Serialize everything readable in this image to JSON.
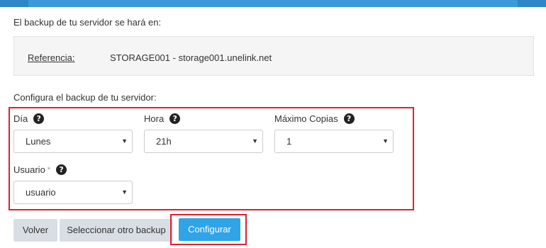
{
  "intro_text": "El backup de tu servidor se hará en:",
  "reference": {
    "label": "Referencia:",
    "value": "STORAGE001 - storage001.unelink.net"
  },
  "config_title": "Configura el backup de tu servidor:",
  "fields": {
    "dia": {
      "label": "Día",
      "value": "Lunes"
    },
    "hora": {
      "label": "Hora",
      "value": "21h"
    },
    "maximo_copias": {
      "label": "Máximo Copias",
      "value": "1"
    },
    "usuario": {
      "label": "Usuario",
      "required_mark": "*",
      "value": "usuario"
    }
  },
  "icons": {
    "help": "?",
    "caret": "▼"
  },
  "buttons": {
    "volver": "Volver",
    "seleccionar": "Seleccionar otro backup",
    "configurar": "Configurar"
  },
  "colors": {
    "header_bar": "#3a9ad9",
    "primary_button": "#2fa4e7",
    "highlight": "#d9232d",
    "secondary_button": "#d9dee4"
  }
}
